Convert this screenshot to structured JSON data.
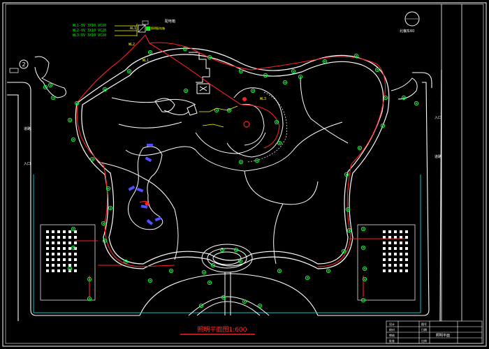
{
  "title_main": "照明平面图1:600",
  "legend": {
    "lines": [
      "WL1-VV 3X10 VC20",
      "WL2-VV 3X10 VC20",
      "WL3-VV 3X10 VC20"
    ],
    "panel_tag": "AL1",
    "panel_note": "配电箱",
    "panel_text": "照明配电箱"
  },
  "circuit_labels": {
    "wl1": "WL1",
    "wl2": "WL2",
    "wl3": "WL3"
  },
  "north": {
    "text": "北偏东60"
  },
  "gate_num": "2",
  "side_labels": {
    "left_road": "道路",
    "right_road": "道路",
    "left_top": "入口",
    "right_top": "入口"
  },
  "title_block": {
    "drawing_name": "照明平面",
    "rows": [
      "设计",
      "校对",
      "审核",
      "批准"
    ],
    "cols": [
      "图号",
      "日期",
      "比例"
    ]
  },
  "colors": {
    "background": "#000000",
    "path": "#ffffff",
    "cable": "#ff2020",
    "fixture": "#00ff40",
    "boundary": "#00c8c8",
    "text": "#ffff00",
    "accent": "#5050ff"
  }
}
